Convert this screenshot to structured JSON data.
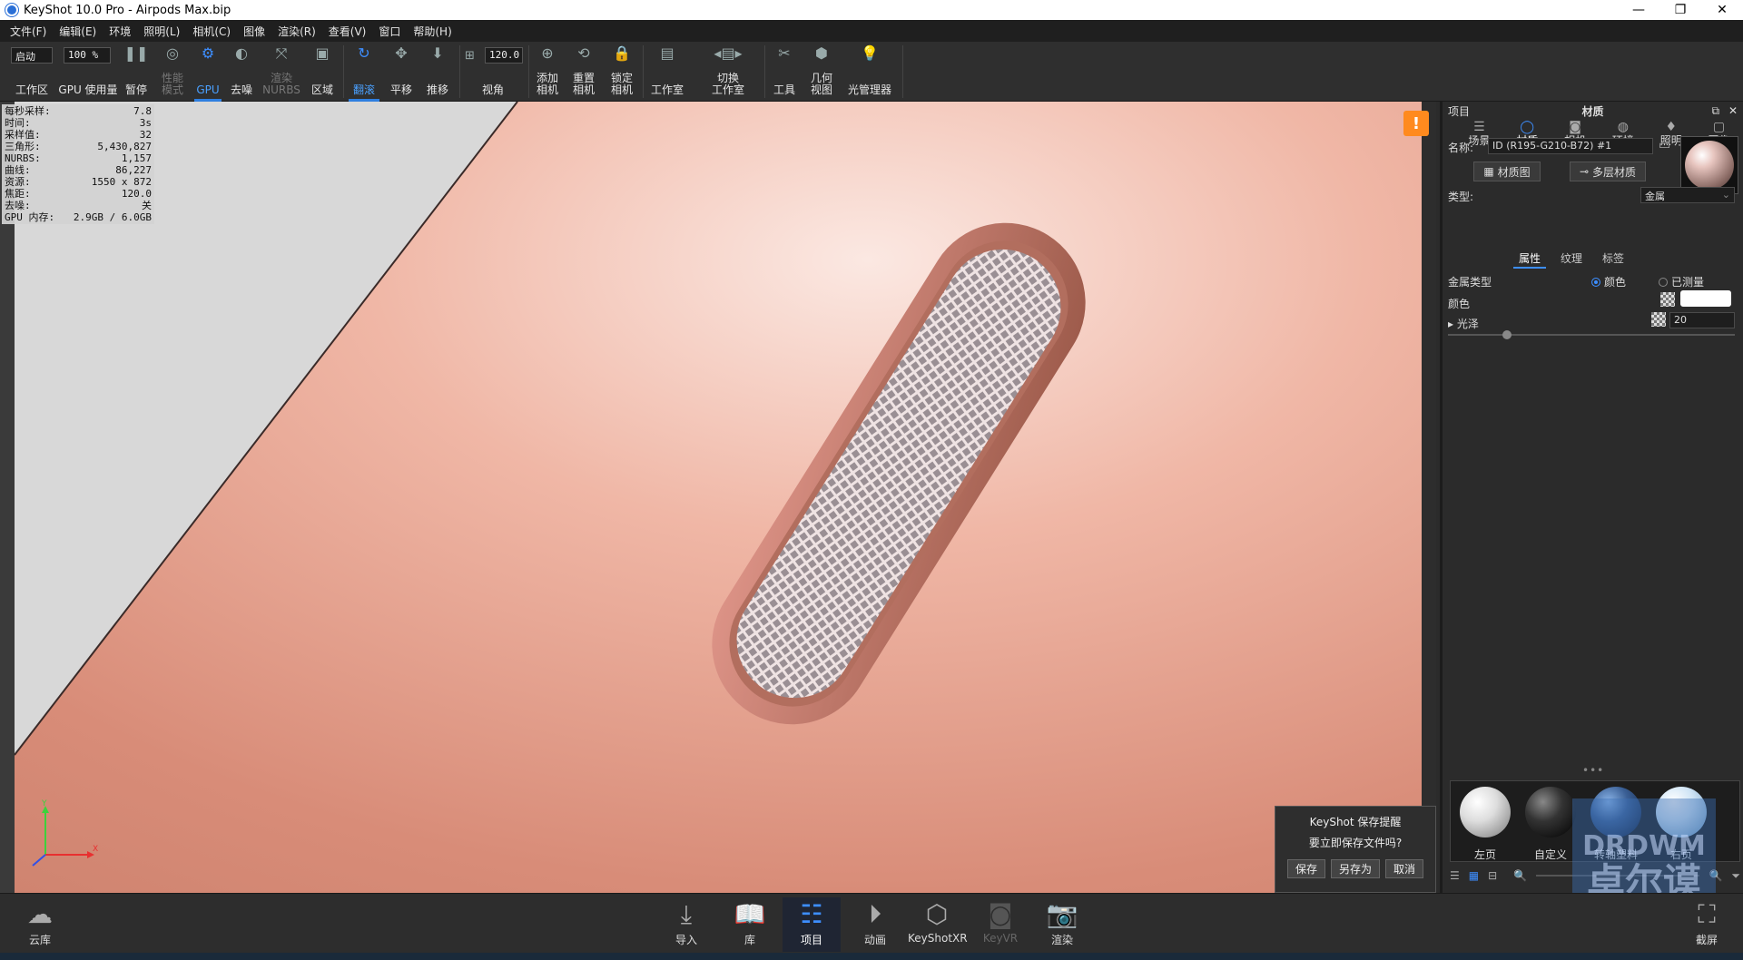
{
  "window": {
    "title": "KeyShot 10.0 Pro  - Airpods Max.bip",
    "controls": [
      "—",
      "❐",
      "✕"
    ]
  },
  "menu": [
    "文件(F)",
    "编辑(E)",
    "环境",
    "照明(L)",
    "相机(C)",
    "图像",
    "渲染(R)",
    "查看(V)",
    "窗口",
    "帮助(H)"
  ],
  "toolbar": {
    "workspace_value": "启动",
    "workspace_label": "工作区",
    "gpu_percent_value": "100 %",
    "gpu_usage_label": "GPU 使用量",
    "pause_label": "暂停",
    "performance_label": "性能\n模式",
    "gpu_label": "GPU",
    "denoise_label": "去噪",
    "render_nurbs_label": "渲染\nNURBS",
    "region_label": "区域",
    "tumble_label": "翻滚",
    "pan_label": "平移",
    "dolly_label": "推移",
    "fov_value": "120.0",
    "fov_label": "视角",
    "add_camera_label": "添加\n相机",
    "reset_camera_label": "重置\n相机",
    "lock_camera_label": "锁定\n相机",
    "studio_label": "工作室",
    "switch_studio_label": "切换\n工作室",
    "tools_label": "工具",
    "geometry_view_label": "几何\n视图",
    "light_manager_label": "光管理器"
  },
  "stats": [
    {
      "label": "每秒采样:",
      "value": "7.8"
    },
    {
      "label": "时间:",
      "value": "3s"
    },
    {
      "label": "采样值:",
      "value": "32"
    },
    {
      "label": "三角形:",
      "value": "5,430,827"
    },
    {
      "label": "NURBS:",
      "value": "1,157"
    },
    {
      "label": "曲线:",
      "value": "86,227"
    },
    {
      "label": "资源:",
      "value": "1550 x 872"
    },
    {
      "label": "焦距:",
      "value": "120.0"
    },
    {
      "label": "去噪:",
      "value": "关"
    },
    {
      "label": "GPU 内存:",
      "value": "2.9GB / 6.0GB"
    }
  ],
  "viewport": {
    "warning_icon": "!",
    "axis_x": "X",
    "axis_y": "Y"
  },
  "save_dialog": {
    "title": "KeyShot 保存提醒",
    "question": "要立即保存文件吗?",
    "save": "保存",
    "save_as": "另存为",
    "cancel": "取消"
  },
  "panel": {
    "left_title": "项目",
    "center_title": "材质",
    "tabs": [
      {
        "label": "场景",
        "icon": "scene-icon"
      },
      {
        "label": "材质",
        "icon": "material-icon"
      },
      {
        "label": "相机",
        "icon": "camera-icon"
      },
      {
        "label": "环境",
        "icon": "environment-icon"
      },
      {
        "label": "照明",
        "icon": "light-icon"
      },
      {
        "label": "图像",
        "icon": "image-icon"
      }
    ],
    "name_label": "名称:",
    "name_value": "ID (R195-G210-B72) #1",
    "material_graph_label": "材质图",
    "multilayer_label": "多层材质",
    "type_label": "类型:",
    "type_value": "金属",
    "subtabs": [
      "属性",
      "纹理",
      "标签"
    ],
    "metal_type_label": "金属类型",
    "metal_type_option1": "颜色",
    "metal_type_option2": "已测量",
    "color_label": "颜色",
    "color_value": "#ffffff",
    "roughness_label": "光泽",
    "roughness_value": "20",
    "library": [
      {
        "label": "左页"
      },
      {
        "label": "自定义"
      },
      {
        "label": "转轴塑料"
      },
      {
        "label": "右页"
      }
    ]
  },
  "watermark": {
    "line1": "DRDWM",
    "line2": "卓尔谟"
  },
  "bottombar": {
    "cloud_label": "云库",
    "import_label": "导入",
    "library_label": "库",
    "project_label": "项目",
    "animation_label": "动画",
    "keyshotxr_label": "KeyShotXR",
    "keyvr_label": "KeyVR",
    "render_label": "渲染",
    "screenshot_label": "截屏"
  },
  "colors": {
    "accent": "#2f7fe0",
    "copper": "#e8a592",
    "warning": "#ff8a1e"
  }
}
